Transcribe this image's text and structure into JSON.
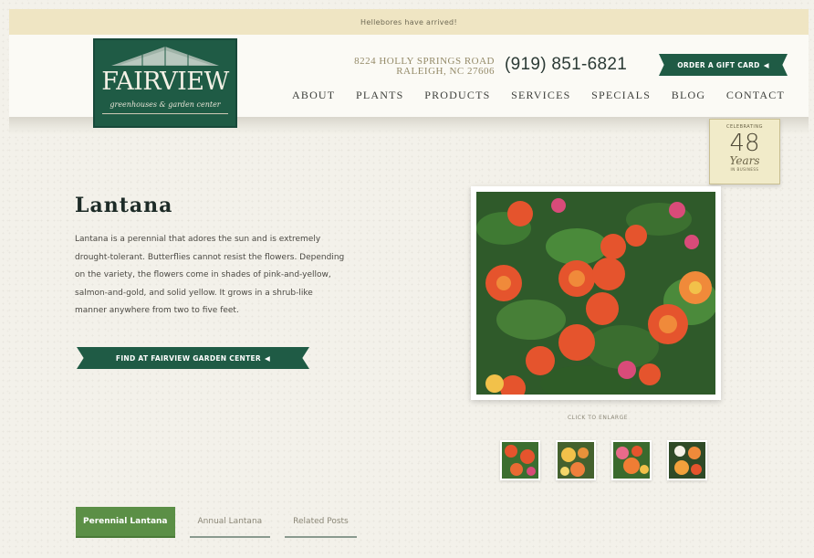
{
  "announcement": "Hellebores have arrived!",
  "logo": {
    "name": "FAIRVIEW",
    "subtitle": "greenhouses & garden center"
  },
  "address": {
    "line1": "8224 HOLLY SPRINGS ROAD",
    "line2": "RALEIGH, NC 27606"
  },
  "phone": "(919) 851-6821",
  "gift_card": {
    "label": "ORDER A GIFT CARD",
    "icon": "arrow-icon"
  },
  "nav": [
    "ABOUT",
    "PLANTS",
    "PRODUCTS",
    "SERVICES",
    "SPECIALS",
    "BLOG",
    "CONTACT"
  ],
  "badge": {
    "top": "CELEBRATING",
    "number": "48",
    "years": "Years",
    "bottom": "IN BUSINESS"
  },
  "plant": {
    "title": "Lantana",
    "description": "Lantana is a perennial that adores the sun and is extremely drought-tolerant. Butterflies cannot resist the flowers. Depending on the variety, the flowers come in shades of pink-and-yellow, salmon-and-gold, and solid yellow. It grows in a shrub-like manner anywhere from two to five feet.",
    "find_button": "FIND AT FAIRVIEW GARDEN CENTER",
    "enlarge_hint": "CLICK TO ENLARGE"
  },
  "tabs": [
    {
      "label": "Perennial Lantana",
      "active": true
    },
    {
      "label": "Annual Lantana",
      "active": false
    },
    {
      "label": "Related Posts",
      "active": false
    }
  ],
  "colors": {
    "brand_green": "#1f5b45",
    "tab_active": "#5b8f46",
    "announce_bg": "#efe5c3"
  }
}
